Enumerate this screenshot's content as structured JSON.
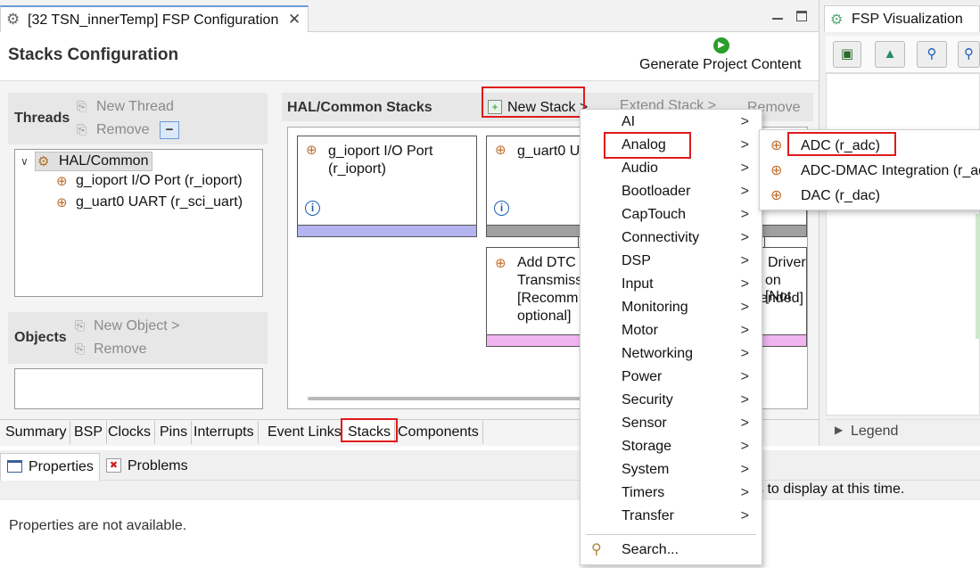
{
  "editor_tab": {
    "title": "[32 TSN_innerTemp] FSP Configuration"
  },
  "viz_tab": {
    "title": "FSP Visualization"
  },
  "page_title": "Stacks Configuration",
  "generate_label": "Generate Project Content",
  "threads": {
    "title": "Threads",
    "new_thread": "New Thread",
    "remove": "Remove",
    "tree": {
      "root": "HAL/Common",
      "children": [
        "g_ioport I/O Port (r_ioport)",
        "g_uart0 UART (r_sci_uart)"
      ]
    }
  },
  "objects": {
    "title": "Objects",
    "new_object": "New Object >",
    "remove": "Remove"
  },
  "hal_stacks": {
    "title": "HAL/Common Stacks",
    "new_stack": "New Stack >",
    "extend_stack": "Extend Stack >",
    "remove": "Remove",
    "box1": {
      "line1": "g_ioport I/O Port",
      "line2": "(r_ioport)"
    },
    "box2": {
      "line1": "g_uart0 U"
    },
    "box3": {
      "line1": "Add DTC",
      "line2": "Transmiss",
      "line3": "[Recomm",
      "line4": "optional]"
    },
    "box3_right": {
      "line1": "Driver",
      "line2": "on [Not",
      "line3": "ended]"
    }
  },
  "bottom_tabs": [
    "Summary",
    "BSP",
    "Clocks",
    "Pins",
    "Interrupts",
    "Event Links",
    "Stacks",
    "Components"
  ],
  "lower_panel": {
    "tab_properties": "Properties",
    "tab_problems": "Problems",
    "message": "Properties are not available.",
    "right_message": "s to display at this time."
  },
  "legend_label": "Legend",
  "menu": {
    "items": [
      "AI",
      "Analog",
      "Audio",
      "Bootloader",
      "CapTouch",
      "Connectivity",
      "DSP",
      "Input",
      "Monitoring",
      "Motor",
      "Networking",
      "Power",
      "Security",
      "Sensor",
      "Storage",
      "System",
      "Timers",
      "Transfer"
    ],
    "search": "Search...",
    "arrow": ">"
  },
  "submenu": {
    "items": [
      "ADC (r_adc)",
      "ADC-DMAC Integration (r_ad",
      "DAC (r_dac)"
    ]
  },
  "colors": {
    "highlight_red": "#e01b1b",
    "stack_bar_purple": "#b4b4f0",
    "stack_bar_gray": "#a0a0a0",
    "stack_bar_pink": "#f0b4f0",
    "panel_gray": "#ebebeb",
    "info_blue": "#1a5fb4",
    "run_green": "#2a9d2a"
  }
}
